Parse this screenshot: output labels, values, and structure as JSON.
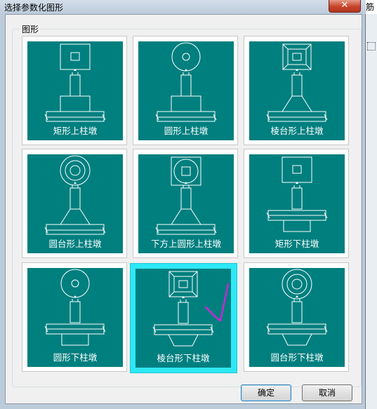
{
  "dialog": {
    "title": "选择参数化图形",
    "close_glyph": "✕",
    "group_label": "图形",
    "ok_label": "确定",
    "cancel_label": "取消"
  },
  "background_app": {
    "edge_text": "筋"
  },
  "shapes": [
    {
      "label": "矩形上柱墩",
      "top": "rect",
      "pier": "rect",
      "beam": "top",
      "selected": false
    },
    {
      "label": "圆形上柱墩",
      "top": "circle",
      "pier": "rect",
      "beam": "top",
      "selected": false
    },
    {
      "label": "棱台形上柱墩",
      "top": "frustum",
      "pier": "trap",
      "beam": "top",
      "selected": false
    },
    {
      "label": "圆台形上柱墩",
      "top": "cone",
      "pier": "trap",
      "beam": "top",
      "selected": false
    },
    {
      "label": "下方上圆形上柱墩",
      "top": "squarecircle",
      "pier": "trap",
      "beam": "top",
      "selected": false
    },
    {
      "label": "矩形下柱墩",
      "top": "rect",
      "pier": "rect",
      "beam": "bottom",
      "selected": false
    },
    {
      "label": "圆形下柱墩",
      "top": "circle",
      "pier": "rect",
      "beam": "bottom",
      "selected": false
    },
    {
      "label": "棱台形下柱墩",
      "top": "frustum",
      "pier": "trap",
      "beam": "bottom",
      "selected": true
    },
    {
      "label": "圆台形下柱墩",
      "top": "cone",
      "pier": "trap",
      "beam": "bottom",
      "selected": false
    }
  ],
  "colors": {
    "tile_bg": "#007f7f",
    "line": "#ffffff",
    "selection": "#2ee8f5",
    "annotation": "#c22ccf"
  }
}
